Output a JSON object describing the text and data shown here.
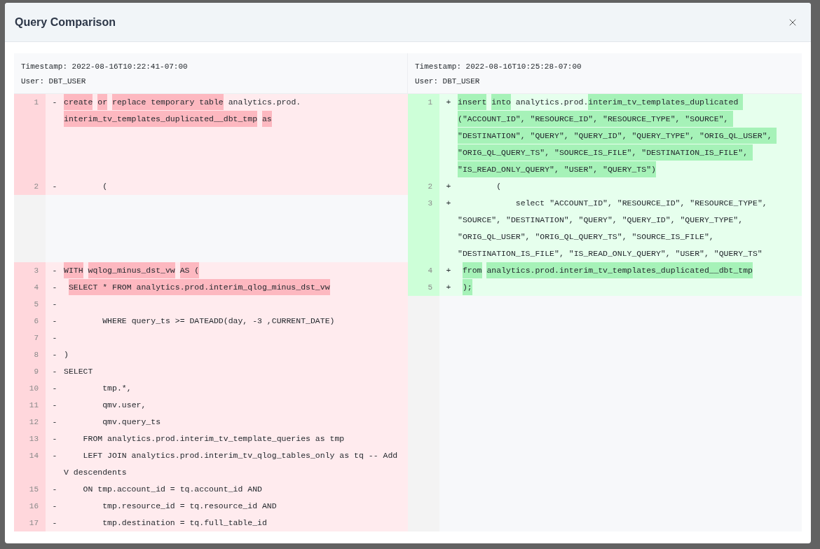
{
  "dialog": {
    "title": "Query Comparison"
  },
  "panes": [
    {
      "timestamp": "Timestamp: 2022-08-16T10:22:41-07:00",
      "user": "User: DBT_USER"
    },
    {
      "timestamp": "Timestamp: 2022-08-16T10:25:28-07:00",
      "user": "User: DBT_USER"
    }
  ],
  "rows": [
    {
      "left": {
        "number": "1",
        "sign": "-",
        "kind": "removed",
        "segments": [
          {
            "text": "create ",
            "changed": true
          },
          {
            "text": "or ",
            "changed": true
          },
          {
            "text": "replace temporary table ",
            "changed": true
          },
          {
            "text": "analytics.prod.",
            "changed": false
          },
          {
            "text": "interim_tv_templates_duplicated__dbt_tmp ",
            "changed": true
          },
          {
            "text": "as",
            "changed": true
          }
        ]
      },
      "right": {
        "number": "1",
        "sign": "+",
        "kind": "added",
        "segments": [
          {
            "text": "insert ",
            "changed": true
          },
          {
            "text": "into",
            "changed": true
          },
          {
            "text": " analytics.prod.",
            "changed": false
          },
          {
            "text": "interim_tv_templates_duplicated (\"ACCOUNT_ID\", \"RESOURCE_ID\", \"RESOURCE_TYPE\", \"SOURCE\", \"DESTINATION\", \"QUERY\", \"QUERY_ID\", \"QUERY_TYPE\", \"ORIG_QL_USER\", \"ORIG_QL_QUERY_TS\", \"SOURCE_IS_FILE\", \"DESTINATION_IS_FILE\", \"IS_READ_ONLY_QUERY\", \"USER\", \"QUERY_TS\")",
            "changed": true
          }
        ]
      }
    },
    {
      "left": {
        "number": "2",
        "sign": "-",
        "kind": "removed",
        "segments": [
          {
            "text": "        (",
            "changed": false
          }
        ]
      },
      "right": {
        "number": "2",
        "sign": "+",
        "kind": "added",
        "segments": [
          {
            "text": "        (",
            "changed": false
          }
        ]
      }
    },
    {
      "right": {
        "number": "3",
        "sign": "+",
        "kind": "added",
        "segments": [
          {
            "text": "            select \"ACCOUNT_ID\", \"RESOURCE_ID\", \"RESOURCE_TYPE\", \"SOURCE\", \"DESTINATION\", \"QUERY\", \"QUERY_ID\", \"QUERY_TYPE\", \"ORIG_QL_USER\", \"ORIG_QL_QUERY_TS\", \"SOURCE_IS_FILE\", \"DESTINATION_IS_FILE\", \"IS_READ_ONLY_QUERY\", \"USER\", \"QUERY_TS\"",
            "changed": false
          }
        ]
      }
    },
    {
      "left": {
        "number": "3",
        "sign": "-",
        "kind": "removed",
        "segments": [
          {
            "text": "WITH ",
            "changed": true
          },
          {
            "text": "wqlog_minus_dst_vw ",
            "changed": true
          },
          {
            "text": "AS (",
            "changed": true
          }
        ]
      },
      "right": {
        "number": "4",
        "sign": "+",
        "kind": "added",
        "segments": [
          {
            "text": " from ",
            "changed": true
          },
          {
            "text": "analytics.prod.interim_tv_templates_duplicated__dbt_tmp",
            "changed": true
          }
        ]
      }
    },
    {
      "left": {
        "number": "4",
        "sign": "-",
        "kind": "removed",
        "segments": [
          {
            "text": " SELECT * FROM analytics.prod.interim_qlog_minus_dst_vw",
            "changed": true
          }
        ]
      },
      "right": {
        "number": "5",
        "sign": "+",
        "kind": "added",
        "segments": [
          {
            "text": " );",
            "changed": true
          }
        ]
      }
    },
    {
      "left": {
        "number": "5",
        "sign": "-",
        "kind": "removed"
      }
    },
    {
      "left": {
        "number": "6",
        "sign": "-",
        "kind": "removed",
        "segments": [
          {
            "text": "        WHERE query_ts >= DATEADD(day, -3 ,CURRENT_DATE)",
            "changed": false
          }
        ]
      }
    },
    {
      "left": {
        "number": "7",
        "sign": "-",
        "kind": "removed"
      }
    },
    {
      "left": {
        "number": "8",
        "sign": "-",
        "kind": "removed",
        "segments": [
          {
            "text": ")",
            "changed": false
          }
        ]
      }
    },
    {
      "left": {
        "number": "9",
        "sign": "-",
        "kind": "removed",
        "segments": [
          {
            "text": "SELECT",
            "changed": false
          }
        ]
      }
    },
    {
      "left": {
        "number": "10",
        "sign": "-",
        "kind": "removed",
        "segments": [
          {
            "text": "        tmp.*,",
            "changed": false
          }
        ]
      }
    },
    {
      "left": {
        "number": "11",
        "sign": "-",
        "kind": "removed",
        "segments": [
          {
            "text": "        qmv.user,",
            "changed": false
          }
        ]
      }
    },
    {
      "left": {
        "number": "12",
        "sign": "-",
        "kind": "removed",
        "segments": [
          {
            "text": "        qmv.query_ts",
            "changed": false
          }
        ]
      }
    },
    {
      "left": {
        "number": "13",
        "sign": "-",
        "kind": "removed",
        "segments": [
          {
            "text": "    FROM analytics.prod.interim_tv_template_queries as tmp",
            "changed": false
          }
        ]
      }
    },
    {
      "left": {
        "number": "14",
        "sign": "-",
        "kind": "removed",
        "segments": [
          {
            "text": "    LEFT JOIN analytics.prod.interim_tv_qlog_tables_only as tq -- Add V descendents",
            "changed": false
          }
        ]
      }
    },
    {
      "left": {
        "number": "15",
        "sign": "-",
        "kind": "removed",
        "segments": [
          {
            "text": "    ON tmp.account_id = tq.account_id AND",
            "changed": false
          }
        ]
      }
    },
    {
      "left": {
        "number": "16",
        "sign": "-",
        "kind": "removed",
        "segments": [
          {
            "text": "        tmp.resource_id = tq.resource_id AND",
            "changed": false
          }
        ]
      }
    },
    {
      "left": {
        "number": "17",
        "sign": "-",
        "kind": "removed",
        "segments": [
          {
            "text": "        tmp.destination = tq.full_table_id",
            "changed": false
          }
        ]
      }
    }
  ]
}
